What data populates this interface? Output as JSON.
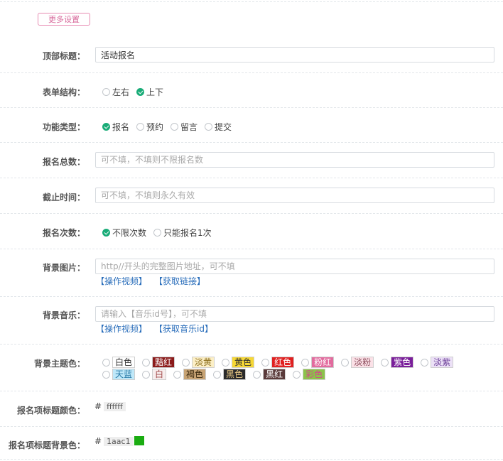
{
  "more_settings_button": "更多设置",
  "colors": {
    "check": "#1aac78",
    "link": "#2a6ebb",
    "pill": "#d86b9c"
  },
  "fields": {
    "top_title": {
      "label": "顶部标题：",
      "value": "活动报名"
    },
    "form_structure": {
      "label": "表单结构：",
      "options": [
        "左右",
        "上下"
      ],
      "selected": "上下"
    },
    "function_type": {
      "label": "功能类型：",
      "options": [
        "报名",
        "预约",
        "留言",
        "提交"
      ],
      "selected": "报名"
    },
    "total_count": {
      "label": "报名总数：",
      "placeholder": "可不填，不填则不限报名数"
    },
    "deadline": {
      "label": "截止时间：",
      "placeholder": "可不填，不填则永久有效"
    },
    "signup_times": {
      "label": "报名次数：",
      "options": [
        "不限次数",
        "只能报名1次"
      ],
      "selected": "不限次数"
    },
    "bg_image": {
      "label": "背景图片：",
      "placeholder": "http//开头的完整图片地址，可不填",
      "links": [
        "【操作视频】",
        "【获取链接】"
      ]
    },
    "bg_music": {
      "label": "背景音乐：",
      "placeholder": "请输入【音乐id号】，可不填",
      "links": [
        "【操作视频】",
        "【获取音乐id】"
      ]
    },
    "theme_color": {
      "label": "背景主题色：",
      "options": [
        {
          "name": "白色",
          "bg": "#ffffff",
          "fg": "#333333"
        },
        {
          "name": "黯红",
          "bg": "#8b1a1a",
          "fg": "#ffffff"
        },
        {
          "name": "淡黄",
          "bg": "#fcefc6",
          "fg": "#8a6d1b"
        },
        {
          "name": "黄色",
          "bg": "#f7d835",
          "fg": "#333333"
        },
        {
          "name": "红色",
          "bg": "#e02020",
          "fg": "#ffffff"
        },
        {
          "name": "粉红",
          "bg": "#e26b9e",
          "fg": "#ffffff"
        },
        {
          "name": "淡粉",
          "bg": "#fbe1e7",
          "fg": "#8a4a5a"
        },
        {
          "name": "紫色",
          "bg": "#7a1f9a",
          "fg": "#ffffff"
        },
        {
          "name": "淡紫",
          "bg": "#ece1f7",
          "fg": "#6c3f98"
        },
        {
          "name": "天蓝",
          "bg": "#bfe8f9",
          "fg": "#2a7ba8"
        },
        {
          "name": "白",
          "bg": "#f7eeee",
          "fg": "#a04848"
        },
        {
          "name": "褐色",
          "bg": "#c7a374",
          "fg": "#3a2a10"
        },
        {
          "name": "黑色",
          "bg": "#2a2a2a",
          "fg": "#e8c884"
        },
        {
          "name": "黑红",
          "bg": "#5a3a3a",
          "fg": "#ffffff"
        },
        {
          "name": "彩色",
          "bg": "#8bc34a",
          "fg": "#d14a8a"
        }
      ]
    },
    "title_color": {
      "label": "报名项标题颜色：",
      "hash": "#",
      "value": "ffffff",
      "swatch": "#ffffff"
    },
    "title_bg_color": {
      "label": "报名项标题背景色：",
      "hash": "#",
      "value": "1aac1",
      "swatch": "#1aac11"
    }
  }
}
